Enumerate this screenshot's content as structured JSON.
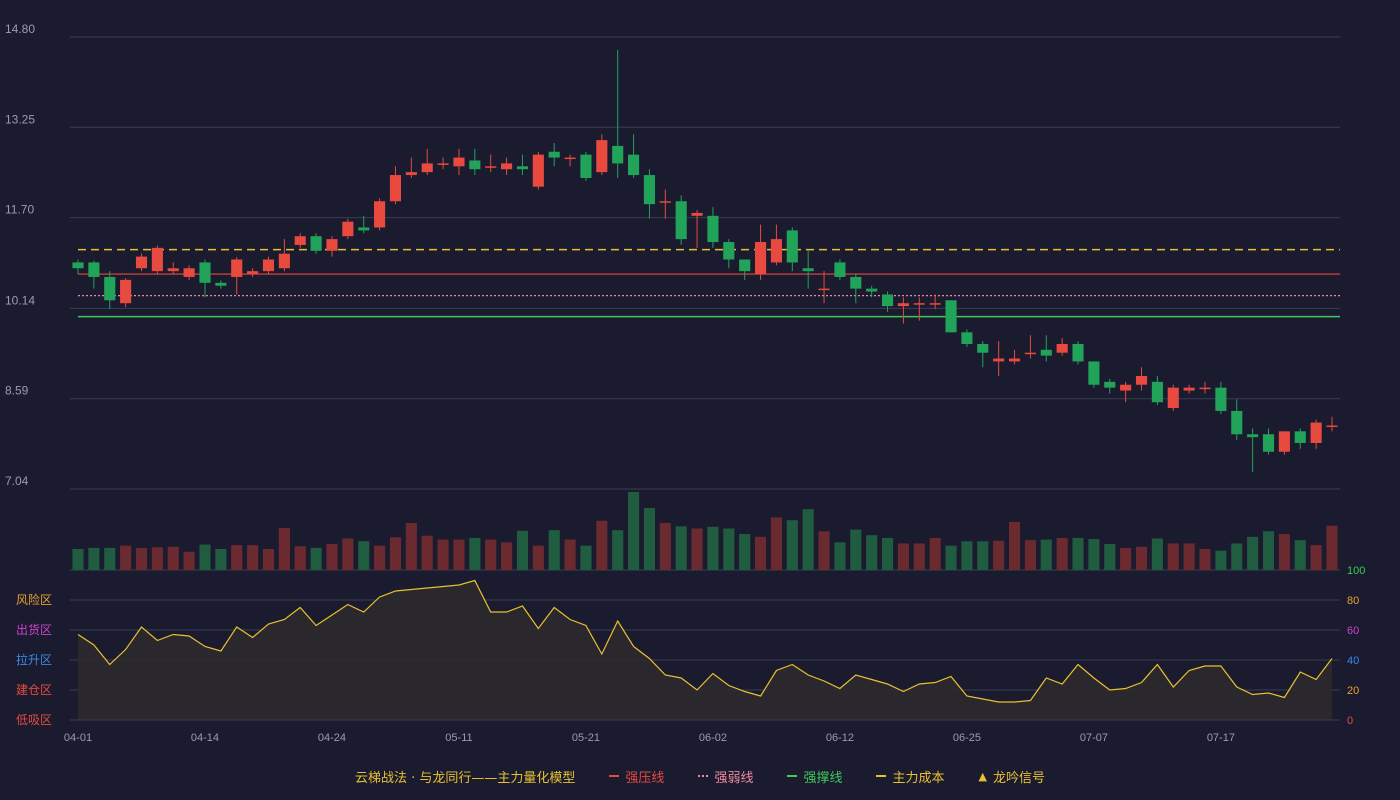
{
  "colors": {
    "bg": "#1a1b2e",
    "grid": "#3a3c50",
    "axis_text": "#9a9cb0",
    "up": "#e84a3f",
    "down": "#22a35a",
    "vol_up": "#6b2a30",
    "vol_down": "#1f5c40",
    "pressure": "#e84a3f",
    "weak": "#f08aa0",
    "support": "#3ec85a",
    "cost": "#e8c030",
    "model_line": "#e8c030",
    "model_fill": "#2c2a2e"
  },
  "legend": {
    "title": "云梯战法 · 与龙同行——主力量化模型",
    "items": [
      {
        "label": "强压线",
        "color": "#e84a3f",
        "style": "solid"
      },
      {
        "label": "强弱线",
        "color": "#f08aa0",
        "style": "dot"
      },
      {
        "label": "强撑线",
        "color": "#3ec85a",
        "style": "solid"
      },
      {
        "label": "主力成本",
        "color": "#e8c030",
        "style": "dash"
      },
      {
        "label": "龙吟信号",
        "color": "#e8c030",
        "style": "tri"
      }
    ]
  },
  "zones": [
    {
      "label": "风险区",
      "color": "#e8a030"
    },
    {
      "label": "出货区",
      "color": "#d040d0"
    },
    {
      "label": "拉升区",
      "color": "#3a8ae8"
    },
    {
      "label": "建仓区",
      "color": "#e84a3f"
    },
    {
      "label": "低吸区",
      "color": "#e84a3f"
    }
  ],
  "chart_data": [
    {
      "type": "candlestick",
      "y_ticks": [
        "14.80",
        "13.25",
        "11.70",
        "10.14",
        "8.59",
        "7.04"
      ],
      "ylim": [
        7.04,
        14.8
      ],
      "x_ticks": [
        {
          "i": 0,
          "label": "04-01"
        },
        {
          "i": 8,
          "label": "04-14"
        },
        {
          "i": 16,
          "label": "04-24"
        },
        {
          "i": 24,
          "label": "05-11"
        },
        {
          "i": 32,
          "label": "05-21"
        },
        {
          "i": 40,
          "label": "06-02"
        },
        {
          "i": 48,
          "label": "06-12"
        },
        {
          "i": 56,
          "label": "06-25"
        },
        {
          "i": 64,
          "label": "07-07"
        },
        {
          "i": 72,
          "label": "07-17"
        }
      ],
      "levels": {
        "pressure": 10.73,
        "weak": 10.36,
        "support": 10.0,
        "cost": 11.15
      },
      "candles": [
        [
          10.93,
          10.83,
          10.98,
          10.73
        ],
        [
          10.93,
          10.68,
          10.96,
          10.48
        ],
        [
          10.68,
          10.28,
          10.78,
          10.13
        ],
        [
          10.23,
          10.63,
          10.66,
          10.16
        ],
        [
          10.83,
          11.03,
          11.08,
          10.78
        ],
        [
          10.78,
          11.18,
          11.22,
          10.73
        ],
        [
          10.78,
          10.83,
          10.93,
          10.73
        ],
        [
          10.68,
          10.83,
          10.88,
          10.63
        ],
        [
          10.93,
          10.58,
          10.98,
          10.33
        ],
        [
          10.58,
          10.53,
          10.62,
          10.48
        ],
        [
          10.68,
          10.98,
          11.02,
          10.38
        ],
        [
          10.73,
          10.78,
          10.83,
          10.68
        ],
        [
          10.78,
          10.98,
          11.03,
          10.73
        ],
        [
          10.83,
          11.08,
          11.33,
          10.78
        ],
        [
          11.23,
          11.38,
          11.43,
          11.18
        ],
        [
          11.38,
          11.13,
          11.43,
          11.08
        ],
        [
          11.13,
          11.33,
          11.38,
          11.03
        ],
        [
          11.38,
          11.63,
          11.68,
          11.33
        ],
        [
          11.53,
          11.48,
          11.73,
          11.43
        ],
        [
          11.53,
          11.98,
          12.03,
          11.48
        ],
        [
          11.98,
          12.43,
          12.58,
          11.93
        ],
        [
          12.43,
          12.48,
          12.73,
          12.38
        ],
        [
          12.48,
          12.63,
          12.88,
          12.43
        ],
        [
          12.63,
          12.63,
          12.73,
          12.53
        ],
        [
          12.58,
          12.73,
          12.88,
          12.43
        ],
        [
          12.68,
          12.53,
          12.88,
          12.43
        ],
        [
          12.58,
          12.58,
          12.78,
          12.48
        ],
        [
          12.53,
          12.63,
          12.73,
          12.43
        ],
        [
          12.58,
          12.53,
          12.78,
          12.43
        ],
        [
          12.23,
          12.78,
          12.83,
          12.18
        ],
        [
          12.83,
          12.73,
          12.98,
          12.58
        ],
        [
          12.73,
          12.73,
          12.78,
          12.58
        ],
        [
          12.78,
          12.38,
          12.83,
          12.33
        ],
        [
          12.48,
          13.03,
          13.13,
          12.43
        ],
        [
          12.93,
          12.63,
          14.58,
          12.38
        ],
        [
          12.78,
          12.43,
          13.13,
          12.38
        ],
        [
          12.43,
          11.93,
          12.53,
          11.68
        ],
        [
          11.98,
          11.98,
          12.18,
          11.68
        ],
        [
          11.98,
          11.33,
          12.08,
          11.23
        ],
        [
          11.73,
          11.78,
          11.83,
          11.18
        ],
        [
          11.73,
          11.28,
          11.88,
          11.18
        ],
        [
          11.28,
          10.98,
          11.33,
          10.83
        ],
        [
          10.98,
          10.78,
          10.98,
          10.63
        ],
        [
          10.73,
          11.28,
          11.58,
          10.63
        ],
        [
          10.93,
          11.33,
          11.58,
          10.88
        ],
        [
          11.48,
          10.93,
          11.53,
          10.78
        ],
        [
          10.83,
          10.78,
          11.13,
          10.48
        ],
        [
          10.48,
          10.48,
          10.78,
          10.23
        ],
        [
          10.93,
          10.68,
          10.98,
          10.63
        ],
        [
          10.68,
          10.48,
          10.73,
          10.23
        ],
        [
          10.48,
          10.43,
          10.53,
          10.33
        ],
        [
          10.38,
          10.18,
          10.43,
          10.08
        ],
        [
          10.18,
          10.23,
          10.33,
          9.88
        ],
        [
          10.23,
          10.23,
          10.33,
          9.93
        ],
        [
          10.23,
          10.23,
          10.38,
          10.13
        ],
        [
          10.28,
          9.73,
          10.28,
          9.73
        ],
        [
          9.73,
          9.53,
          9.78,
          9.48
        ],
        [
          9.53,
          9.38,
          9.58,
          9.13
        ],
        [
          9.23,
          9.28,
          9.58,
          8.98
        ],
        [
          9.23,
          9.28,
          9.43,
          9.18
        ],
        [
          9.38,
          9.38,
          9.68,
          9.28
        ],
        [
          9.43,
          9.33,
          9.68,
          9.23
        ],
        [
          9.38,
          9.53,
          9.63,
          9.33
        ],
        [
          9.53,
          9.23,
          9.58,
          9.18
        ],
        [
          9.23,
          8.83,
          9.23,
          8.78
        ],
        [
          8.88,
          8.78,
          8.93,
          8.68
        ],
        [
          8.73,
          8.83,
          8.88,
          8.53
        ],
        [
          8.83,
          8.98,
          9.13,
          8.73
        ],
        [
          8.88,
          8.53,
          8.98,
          8.48
        ],
        [
          8.43,
          8.78,
          8.83,
          8.38
        ],
        [
          8.73,
          8.78,
          8.83,
          8.68
        ],
        [
          8.78,
          8.78,
          8.88,
          8.68
        ],
        [
          8.78,
          8.38,
          8.88,
          8.33
        ],
        [
          8.38,
          7.98,
          8.58,
          7.88
        ],
        [
          7.98,
          7.93,
          8.08,
          7.33
        ],
        [
          7.98,
          7.68,
          8.08,
          7.63
        ],
        [
          7.68,
          8.03,
          8.03,
          7.63
        ],
        [
          8.03,
          7.83,
          8.08,
          7.73
        ],
        [
          7.83,
          8.18,
          8.23,
          7.73
        ],
        [
          8.13,
          8.13,
          8.28,
          8.03
        ]
      ],
      "volumes": [
        38,
        40,
        40,
        44,
        40,
        41,
        42,
        33,
        46,
        38,
        45,
        45,
        38,
        76,
        43,
        40,
        47,
        57,
        52,
        44,
        59,
        85,
        62,
        55,
        55,
        58,
        55,
        50,
        71,
        44,
        72,
        55,
        44,
        89,
        72,
        141,
        112,
        85,
        79,
        75,
        78,
        75,
        65,
        60,
        95,
        90,
        110,
        70,
        50,
        73,
        63,
        58,
        48,
        48,
        58,
        44,
        52,
        52,
        53,
        87,
        54,
        55,
        58,
        58,
        56,
        47,
        40,
        42,
        57,
        48,
        48,
        38,
        35,
        48,
        60,
        70,
        65,
        54,
        45,
        80
      ]
    },
    {
      "type": "line",
      "y_ticks": [
        "100",
        "80",
        "60",
        "40",
        "20",
        "0"
      ],
      "ylim": [
        0,
        100
      ],
      "values": [
        57,
        50,
        37,
        47,
        62,
        53,
        57,
        56,
        49,
        46,
        62,
        55,
        64,
        67,
        75,
        63,
        70,
        77,
        72,
        82,
        86,
        87,
        88,
        89,
        90,
        93,
        72,
        72,
        76,
        61,
        75,
        67,
        63,
        44,
        66,
        49,
        41,
        30,
        28,
        20,
        31,
        23,
        19,
        16,
        33,
        37,
        30,
        26,
        21,
        30,
        27,
        24,
        19,
        24,
        25,
        29,
        16,
        14,
        12,
        12,
        13,
        28,
        24,
        37,
        28,
        20,
        21,
        25,
        37,
        22,
        33,
        36,
        36,
        22,
        17,
        18,
        15,
        32,
        27,
        41
      ]
    }
  ]
}
